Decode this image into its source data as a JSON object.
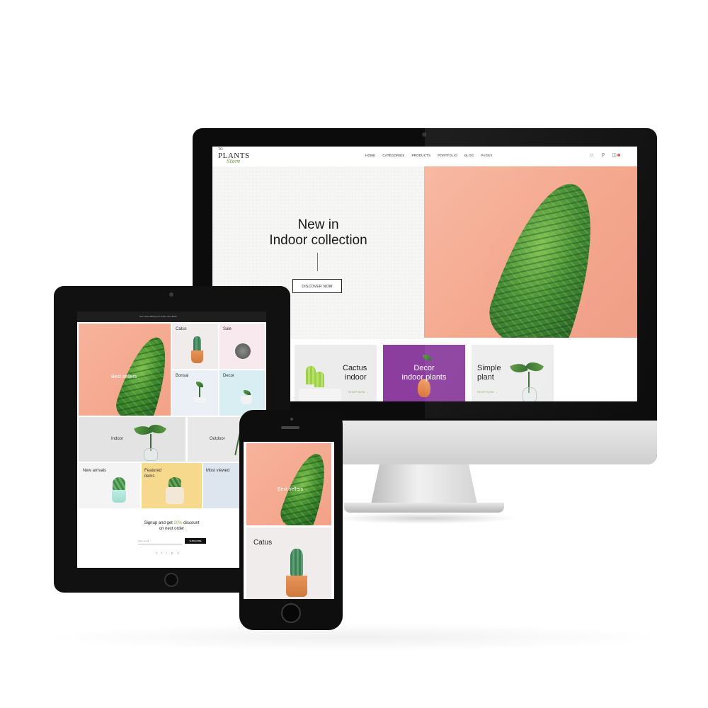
{
  "desktop": {
    "logo": {
      "small": "TO",
      "main": "PLANTS",
      "script": "Store"
    },
    "nav": [
      "HOME",
      "CATEGORIES",
      "PRODUCTS",
      "PORTFOLIO",
      "BLOG",
      "PAGES"
    ],
    "icons": [
      "user-icon",
      "search-icon",
      "cart-icon"
    ],
    "hero": {
      "line1": "New in",
      "line2": "Indoor collection",
      "button": "DISCOVER NOW"
    },
    "categories": [
      {
        "title_line1": "Cactus",
        "title_line2": "indoor",
        "link": "SHOP NOW →",
        "bg": "#ececec"
      },
      {
        "title_line1": "Decor",
        "title_line2": "indoor plants",
        "link": "",
        "bg": "#8b3e9e"
      },
      {
        "title_line1": "Simple",
        "title_line2": "plant",
        "link": "SHOP NOW →",
        "bg": "#ededed"
      }
    ]
  },
  "tablet": {
    "topbar": "Get a free delivery for orders over $100",
    "tiles": {
      "best_sellers": "Best sellers",
      "catus": "Catus",
      "sale": "Sale",
      "bonsai": "Bonsai",
      "decor": "Decor",
      "indoor": "Indoor",
      "outdoor": "Outdoor",
      "new_arrivals": "New arrivals",
      "featured_line1": "Featured",
      "featured_line2": "items",
      "most_viewed": "Most viewed"
    },
    "newsletter": {
      "line1_before": "Signup and get ",
      "highlight": "20%",
      "line1_after": " discount",
      "line2": "on next order",
      "placeholder": "Enter email",
      "button": "SUBSCRIBE"
    },
    "social": [
      "f",
      "t",
      "i",
      "p",
      "y"
    ]
  },
  "phone": {
    "banner": "Best sellers",
    "category": "Catus"
  },
  "colors": {
    "accent": "#f4a489",
    "green": "#7ab04a",
    "purple": "#8b3e9e"
  }
}
